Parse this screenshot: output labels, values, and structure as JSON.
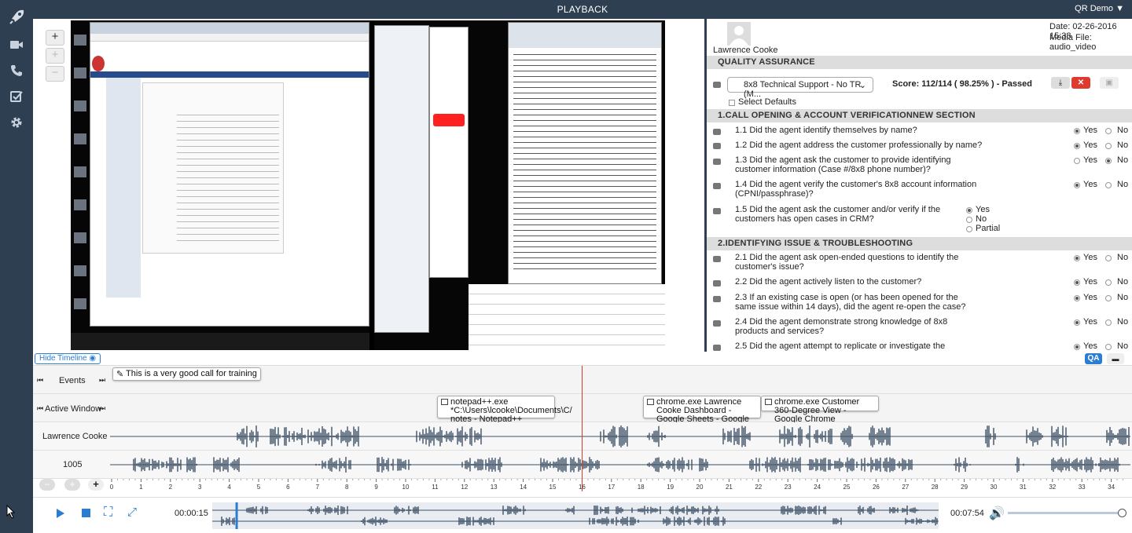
{
  "app": {
    "title": "PLAYBACK",
    "user_menu": "QR Demo ▼"
  },
  "sidebar": {
    "items": [
      {
        "name": "rocket-icon"
      },
      {
        "name": "video-icon"
      },
      {
        "name": "phone-icon"
      },
      {
        "name": "checklist-icon"
      },
      {
        "name": "gear-icon"
      }
    ]
  },
  "video": {
    "zoom_in": "+",
    "zoom_fit": "+",
    "zoom_out": "−"
  },
  "qa": {
    "agent": "Lawrence Cooke",
    "date": "Date: 02-26-2016 15:38",
    "media_file": "Media File: audio_video",
    "section_title": "QUALITY ASSURANCE",
    "form_select": "8x8 Technical Support - No TR (M...",
    "score": "Score: 112/114 ( 98.25% ) - Passed",
    "select_defaults": "Select Defaults",
    "sections": [
      {
        "title": "1.CALL OPENING & ACCOUNT VERIFICATIONNEW SECTION"
      },
      {
        "title": "2.IDENTIFYING ISSUE & TROUBLESHOOTING"
      }
    ],
    "questions": [
      {
        "text": "1.1 Did the agent identify themselves by name?",
        "answer": "Yes"
      },
      {
        "text": "1.2 Did the agent address the customer professionally by name?",
        "answer": "Yes"
      },
      {
        "text": "1.3 Did the agent ask the customer to provide identifying customer information (Case #/8x8 phone number)?",
        "answer": "No"
      },
      {
        "text": "1.4 Did the agent verify the customer's 8x8 account information (CPNI/passphrase)?",
        "answer": "Yes"
      },
      {
        "text": "1.5 Did the agent ask the customer and/or verify if the customers has open cases in CRM?",
        "answer": "Yes"
      },
      {
        "text": "2.1 Did the agent ask open-ended questions to identify the customer's issue?",
        "answer": "Yes"
      },
      {
        "text": "2.2 Did the agent actively listen to the customer?",
        "answer": "Yes"
      },
      {
        "text": "2.3 If an existing case is open (or has been opened for the same issue within 14 days), did the agent re-open the case?",
        "answer": "Yes"
      },
      {
        "text": "2.4 Did the agent demonstrate strong knowledge of 8x8 products and services?",
        "answer": "Yes"
      },
      {
        "text": "2.5 Did the agent attempt to replicate or investigate the",
        "answer": "Yes"
      }
    ],
    "labels": {
      "yes": "Yes",
      "no": "No",
      "partial": "Partial"
    }
  },
  "timeline": {
    "hide_label": "Hide Timeline",
    "qa_tab": "QA",
    "tracks": {
      "events": "Events",
      "active_window": "Active Window",
      "agent": "Lawrence Cooke",
      "ext": "1005"
    },
    "event_note": "This is a very good call for training",
    "windows": [
      {
        "label": "notepad++.exe *C:\\Users\\lcooke\\Documents\\C/ notes - Notepad++"
      },
      {
        "label": "chrome.exe Lawrence Cooke Dashboard - Google Sheets - Google Chrome"
      },
      {
        "label": "chrome.exe Customer 360-Degree View - Google Chrome"
      }
    ],
    "ruler": [
      "0",
      "1",
      "2",
      "3",
      "4",
      "5",
      "6",
      "7",
      "8",
      "9",
      "10",
      "11",
      "12",
      "13",
      "14",
      "15",
      "16",
      "17",
      "18",
      "19",
      "20",
      "21",
      "22",
      "23",
      "24",
      "25",
      "26",
      "27",
      "28",
      "29",
      "30",
      "31",
      "32",
      "33",
      "34"
    ],
    "playhead": 16
  },
  "player": {
    "current_time": "00:00:15",
    "total_time": "00:07:54",
    "progress": 0.032,
    "volume": 1.0
  },
  "colors": {
    "navy": "#2f3f52",
    "accent": "#2a7dd1",
    "wave": "#3d5066",
    "playhead": "#d43b2b",
    "export": "#e03a2f"
  }
}
